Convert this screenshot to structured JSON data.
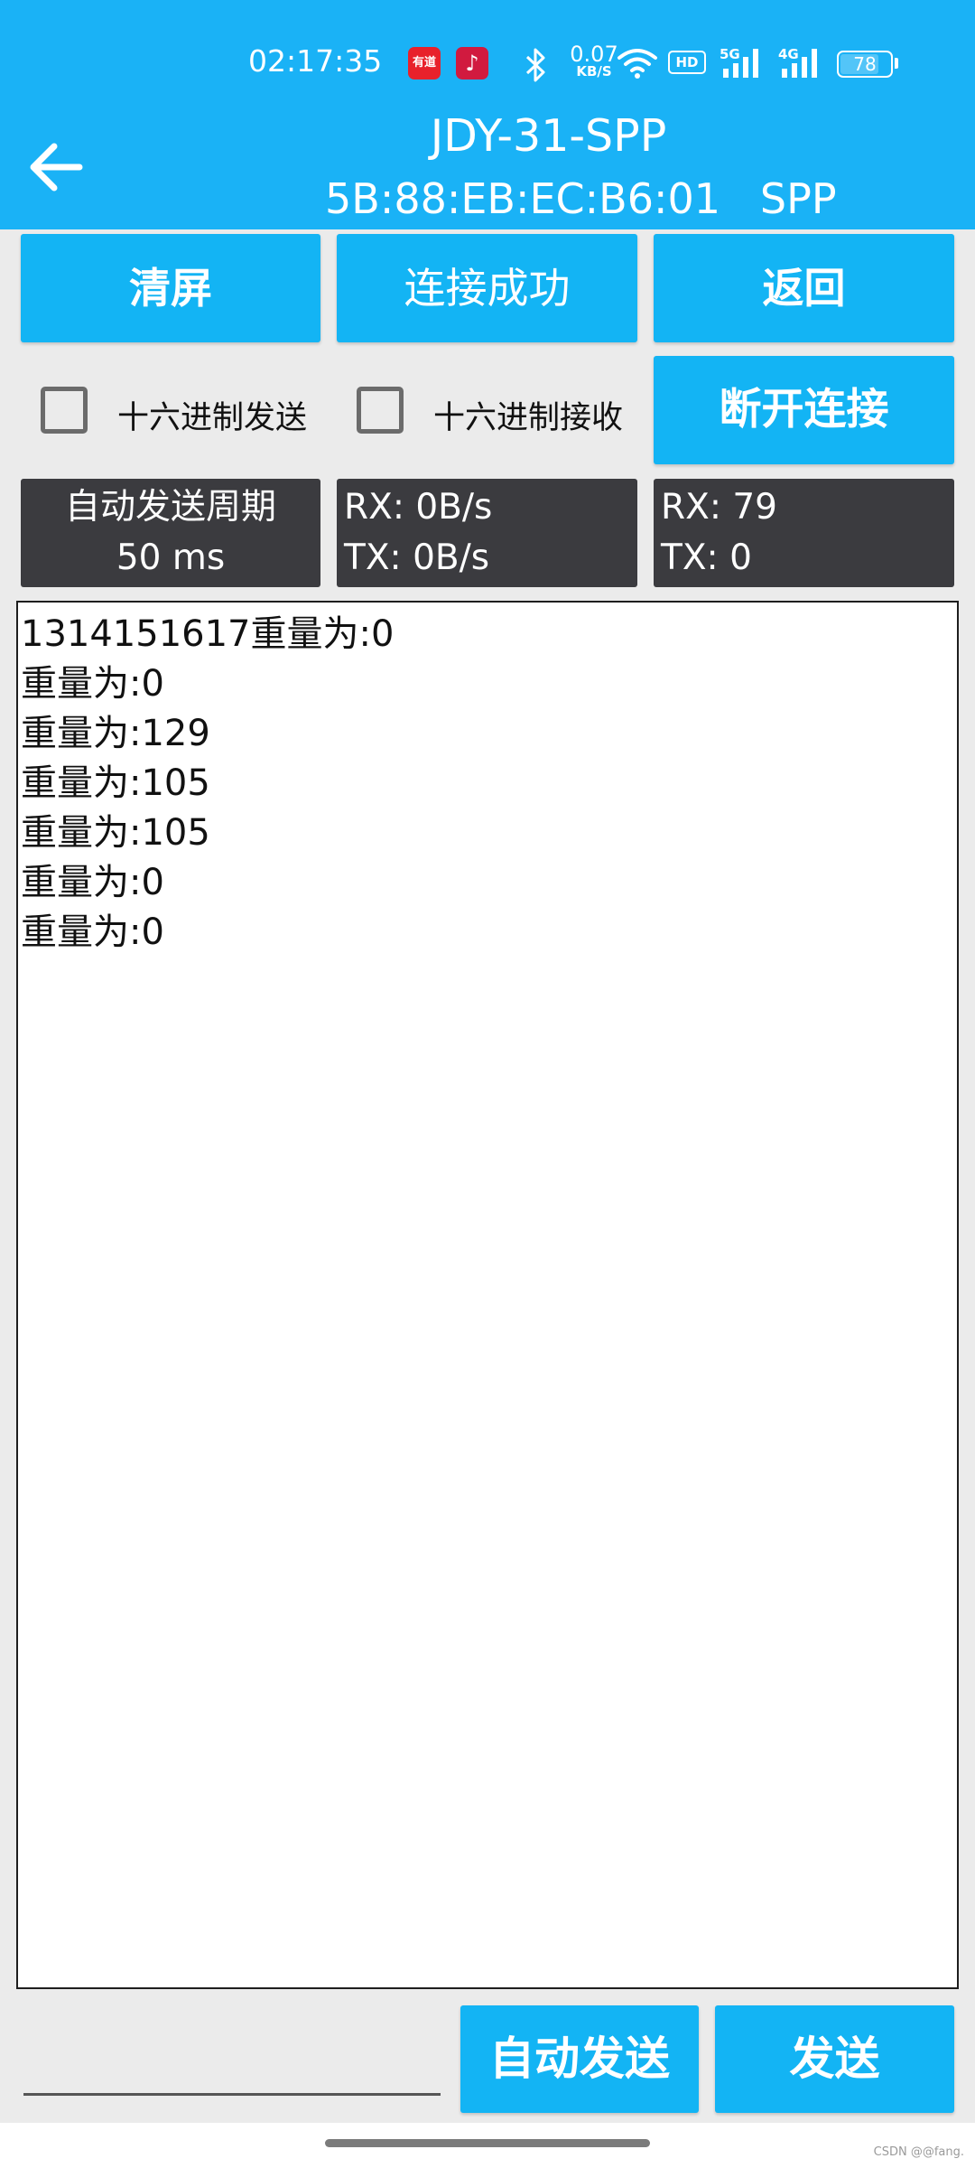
{
  "status_bar": {
    "time": "02:17:35",
    "youdao_icon_text": "有道",
    "net_speed_value": "0.07",
    "net_speed_unit": "KB/S",
    "hd_label": "HD",
    "signal_5g": "5G",
    "signal_4g": "4G",
    "battery_level": "78"
  },
  "header": {
    "device_name": "JDY-31-SPP",
    "device_info": "5B:88:EB:EC:B6:01   SPP"
  },
  "buttons": {
    "clear": "清屏",
    "status": "连接成功",
    "return": "返回",
    "disconnect": "断开连接",
    "auto_send": "自动发送",
    "send": "发送"
  },
  "checkboxes": {
    "hex_send": "十六进制发送",
    "hex_recv": "十六进制接收"
  },
  "panels": {
    "auto_period_label": "自动发送周期",
    "auto_period_value": "50 ms",
    "rx_rate": "RX: 0B/s",
    "tx_rate": "TX: 0B/s",
    "rx_count": "RX: 79",
    "tx_count": "TX: 0"
  },
  "receive_lines": [
    "1314151617重量为:0",
    "重量为:0",
    "重量为:129",
    "重量为:105",
    "重量为:105",
    "重量为:0",
    "重量为:0"
  ],
  "send_input": {
    "value": "",
    "placeholder": ""
  },
  "watermark": "CSDN @@fang."
}
